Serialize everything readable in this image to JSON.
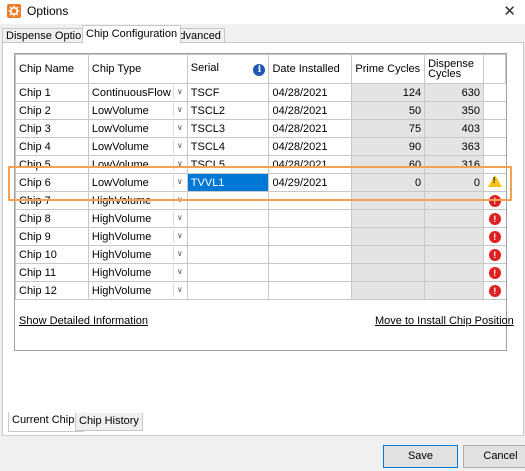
{
  "window": {
    "title": "Options",
    "close_glyph": "✕"
  },
  "tabs": [
    "Dispense Options",
    "Chip Configuration",
    "Advanced"
  ],
  "grid": {
    "headers": {
      "name": "Chip Name",
      "type": "Chip Type",
      "serial": "Serial",
      "date": "Date Installed",
      "prime": "Prime Cycles",
      "dispense": "Dispense Cycles"
    },
    "rows": [
      {
        "name": "Chip 1",
        "type": "ContinuousFlow",
        "serial": "TSCF",
        "date": "04/28/2021",
        "prime": "124",
        "dispense": "630",
        "status": ""
      },
      {
        "name": "Chip 2",
        "type": "LowVolume",
        "serial": "TSCL2",
        "date": "04/28/2021",
        "prime": "50",
        "dispense": "350",
        "status": ""
      },
      {
        "name": "Chip 3",
        "type": "LowVolume",
        "serial": "TSCL3",
        "date": "04/28/2021",
        "prime": "75",
        "dispense": "403",
        "status": ""
      },
      {
        "name": "Chip 4",
        "type": "LowVolume",
        "serial": "TSCL4",
        "date": "04/28/2021",
        "prime": "90",
        "dispense": "363",
        "status": ""
      },
      {
        "name": "Chip 5",
        "type": "LowVolume",
        "serial": "TSCL5",
        "date": "04/28/2021",
        "prime": "60",
        "dispense": "316",
        "status": ""
      },
      {
        "name": "Chip 6",
        "type": "LowVolume",
        "serial": "TVVL1",
        "date": "04/29/2021",
        "prime": "0",
        "dispense": "0",
        "status": "warning"
      },
      {
        "name": "Chip 7",
        "type": "HighVolume",
        "serial": "",
        "date": "",
        "prime": "",
        "dispense": "",
        "status": "error"
      },
      {
        "name": "Chip 8",
        "type": "HighVolume",
        "serial": "",
        "date": "",
        "prime": "",
        "dispense": "",
        "status": "error"
      },
      {
        "name": "Chip 9",
        "type": "HighVolume",
        "serial": "",
        "date": "",
        "prime": "",
        "dispense": "",
        "status": "error"
      },
      {
        "name": "Chip 10",
        "type": "HighVolume",
        "serial": "",
        "date": "",
        "prime": "",
        "dispense": "",
        "status": "error"
      },
      {
        "name": "Chip 11",
        "type": "HighVolume",
        "serial": "",
        "date": "",
        "prime": "",
        "dispense": "",
        "status": "error"
      },
      {
        "name": "Chip 12",
        "type": "HighVolume",
        "serial": "",
        "date": "",
        "prime": "",
        "dispense": "",
        "status": "error"
      }
    ]
  },
  "links": {
    "details": "Show Detailed Information",
    "move": "Move to Install Chip Position"
  },
  "bottom_tabs": [
    "Current Chips",
    "Chip History"
  ],
  "buttons": {
    "save": "Save",
    "cancel": "Cancel"
  },
  "colors": {
    "accent": "#f4a252",
    "selection": "#0078d7",
    "error": "#e02020",
    "warning": "#f2c418"
  }
}
